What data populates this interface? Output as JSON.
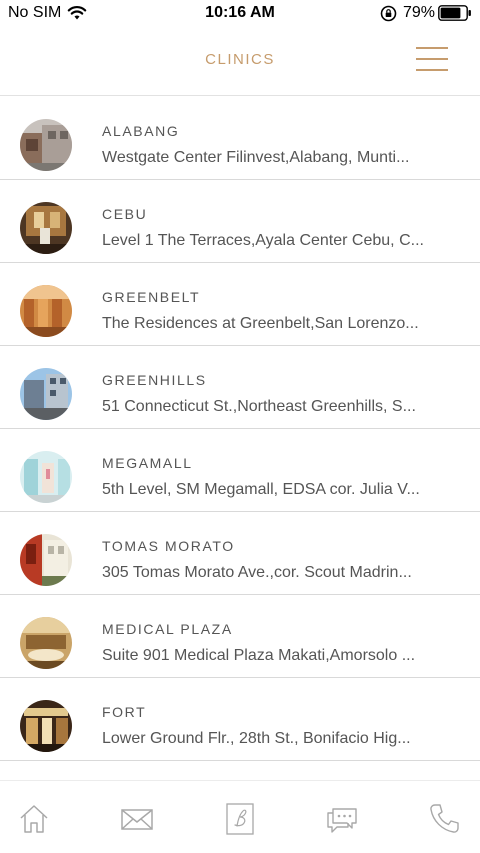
{
  "status_bar": {
    "carrier": "No SIM",
    "time": "10:16 AM",
    "battery_percent": "79%",
    "battery_level": 0.79
  },
  "header": {
    "title": "CLINICS",
    "menu_icon": "hamburger-menu-icon"
  },
  "clinics": [
    {
      "name": "ALABANG",
      "address": "Westgate Center Filinvest,Alabang, Munti..."
    },
    {
      "name": "CEBU",
      "address": "Level 1 The Terraces,Ayala Center Cebu, C..."
    },
    {
      "name": "GREENBELT",
      "address": "The Residences at Greenbelt,San Lorenzo..."
    },
    {
      "name": "GREENHILLS",
      "address": "51 Connecticut St.,Northeast Greenhills, S..."
    },
    {
      "name": "MEGAMALL",
      "address": "5th Level, SM Megamall, EDSA cor. Julia V..."
    },
    {
      "name": "TOMAS MORATO",
      "address": "305 Tomas Morato Ave.,cor. Scout Madrin..."
    },
    {
      "name": "MEDICAL PLAZA",
      "address": "Suite 901 Medical Plaza Makati,Amorsolo ..."
    },
    {
      "name": "FORT",
      "address": "Lower Ground Flr., 28th St., Bonifacio Hig..."
    }
  ],
  "tab_bar": {
    "tabs": [
      {
        "icon": "home-icon"
      },
      {
        "icon": "mail-icon"
      },
      {
        "icon": "brand-logo-icon"
      },
      {
        "icon": "chat-icon"
      },
      {
        "icon": "phone-icon"
      }
    ]
  },
  "colors": {
    "accent": "#c69c6d",
    "text": "#555555",
    "divider": "#d9d9d9",
    "icon": "#a8a8a8"
  }
}
